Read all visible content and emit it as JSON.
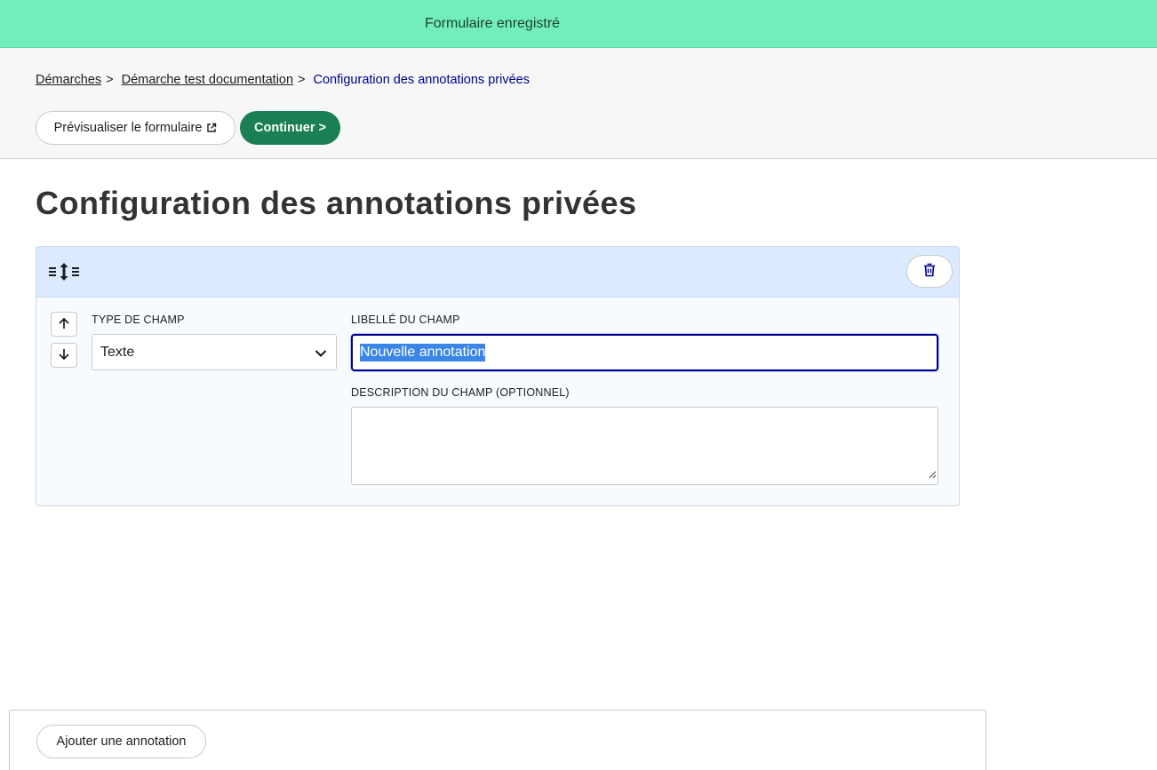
{
  "flash": {
    "message": "Formulaire enregistré",
    "color": "#72eebb"
  },
  "breadcrumb": {
    "items": [
      {
        "label": "Démarches",
        "separator": ">"
      },
      {
        "label": "Démarche test documentation",
        "separator": ">"
      }
    ],
    "current": "Configuration des annotations privées"
  },
  "actions": {
    "preview_label": "Prévisualiser le formulaire",
    "preview_icon": "external-link-icon",
    "continue_label": "Continuer >",
    "continue_color": "#1a7f52"
  },
  "page": {
    "title": "Configuration des annotations privées"
  },
  "annotation": {
    "type_label": "TYPE DE CHAMP",
    "type_value": "Texte",
    "libelle_label": "LIBELLÉ DU CHAMP",
    "libelle_value": "Nouvelle annotation",
    "description_label": "DESCRIPTION DU CHAMP (OPTIONNEL)",
    "description_value": "",
    "icons": {
      "drag": "drag-handle-icon",
      "delete": "trash-icon",
      "move_up": "arrow-up-icon",
      "move_down": "arrow-down-icon",
      "select": "chevron-down-icon"
    }
  },
  "footer": {
    "add_label": "Ajouter une annotation"
  }
}
